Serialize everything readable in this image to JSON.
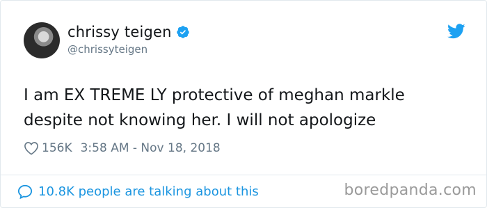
{
  "author": {
    "display_name": "chrissy teigen",
    "handle": "@chrissyteigen"
  },
  "tweet": {
    "text_line1": "I am EX TREME LY protective of meghan markle",
    "text_line2": "despite not knowing her. I will not apologize",
    "likes": "156K",
    "timestamp": "3:58 AM - Nov 18, 2018"
  },
  "footer": {
    "conversation_label": "10.8K people are talking about this"
  },
  "watermark": "boredpanda.com",
  "icons": {
    "verified": "verified-badge-icon",
    "brand": "twitter-bird-icon",
    "like": "heart-icon",
    "conversation": "speech-bubble-icon"
  },
  "colors": {
    "accent": "#1da1f2",
    "link": "#1b95e0",
    "muted": "#657786",
    "text": "#14171a"
  }
}
